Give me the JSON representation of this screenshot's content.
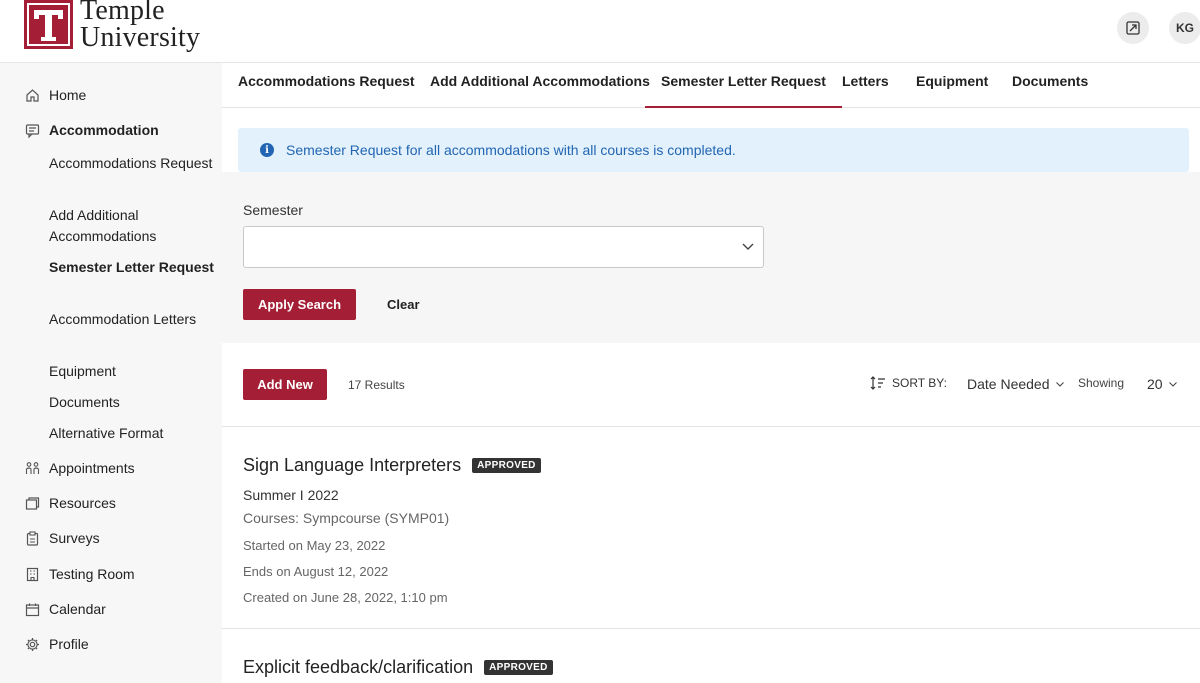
{
  "header": {
    "logo_line1": "Temple",
    "logo_line2": "University",
    "expand_icon": "expand-icon",
    "avatar_initials": "KG"
  },
  "sidebar": {
    "items": [
      {
        "label": "Home",
        "icon": "home-icon"
      },
      {
        "label": "Accommodation",
        "icon": "accommodation-icon"
      },
      {
        "label": "Appointments",
        "icon": "appointments-icon"
      },
      {
        "label": "Resources",
        "icon": "resources-icon"
      },
      {
        "label": "Surveys",
        "icon": "clipboard-icon"
      },
      {
        "label": "Testing Room",
        "icon": "building-icon"
      },
      {
        "label": "Calendar",
        "icon": "calendar-icon"
      },
      {
        "label": "Profile",
        "icon": "gear-icon"
      }
    ],
    "sub_items": [
      {
        "label": "Accommodations Request"
      },
      {
        "label": "Add Additional Accommodations"
      },
      {
        "label": "Semester Letter Request",
        "active": true
      },
      {
        "label": "Accommodation Letters"
      },
      {
        "label": "Equipment"
      },
      {
        "label": "Documents"
      },
      {
        "label": "Alternative Format"
      }
    ]
  },
  "tabs": [
    {
      "label": "Accommodations Request"
    },
    {
      "label": "Add Additional Accommodations"
    },
    {
      "label": "Semester Letter Request",
      "active": true
    },
    {
      "label": "Letters"
    },
    {
      "label": "Equipment"
    },
    {
      "label": "Documents"
    }
  ],
  "alert": {
    "message": "Semester Request for all accommodations with all courses is completed."
  },
  "filter": {
    "semester_label": "Semester",
    "semester_value": "",
    "apply_label": "Apply Search",
    "clear_label": "Clear"
  },
  "results": {
    "add_label": "Add New",
    "count": "17 Results",
    "sort_label": "SORT BY:",
    "sort_value": "Date Needed",
    "showing_label": "Showing",
    "showing_value": "20"
  },
  "cards": [
    {
      "title": "Sign Language Interpreters",
      "status": "APPROVED",
      "term": "Summer I 2022",
      "courses": "Courses: Sympcourse (SYMP01)",
      "started": "Started on May 23, 2022",
      "ends": "Ends on August 12, 2022",
      "created": "Created on June 28, 2022, 1:10 pm"
    },
    {
      "title": "Explicit feedback/clarification",
      "status": "APPROVED"
    }
  ],
  "colors": {
    "brand": "#a41e35",
    "alert_bg": "#e3f1fc",
    "alert_text": "#2266b3"
  }
}
